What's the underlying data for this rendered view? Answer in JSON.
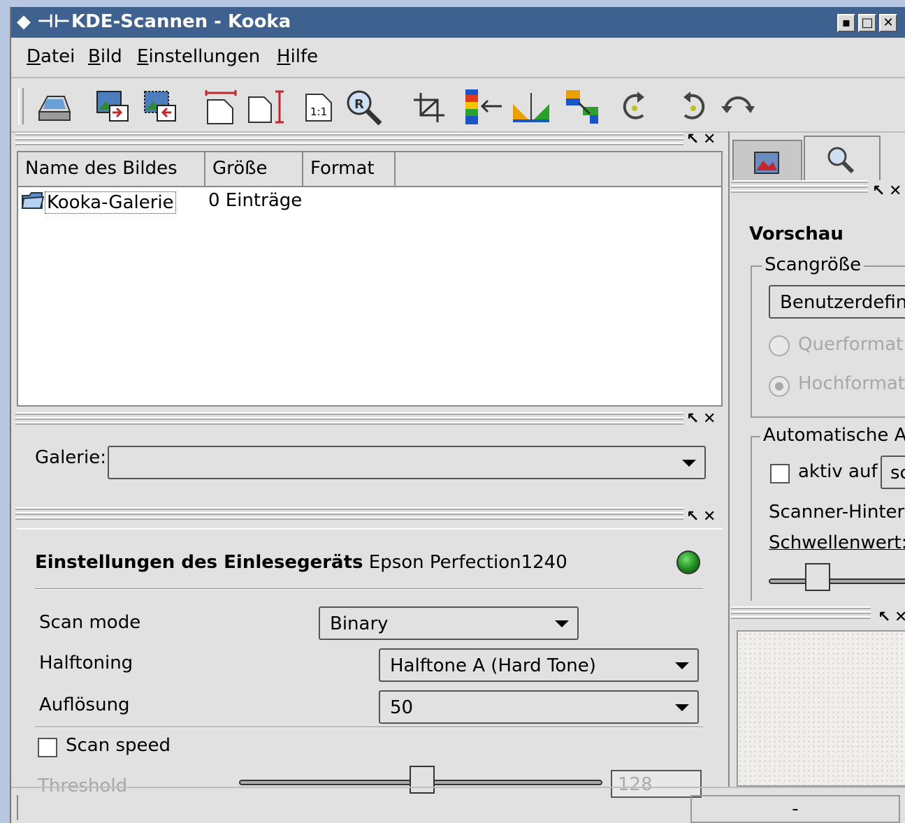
{
  "window": {
    "title": "KDE-Scannen - Kooka",
    "buttons": {
      "minimize": "▪",
      "maximize": "□",
      "close": "✕"
    }
  },
  "menu": [
    {
      "label_u": "D",
      "label_rest": "atei"
    },
    {
      "label_u": "B",
      "label_rest": "ild"
    },
    {
      "label_u": "E",
      "label_rest": "instellungen"
    },
    {
      "label_u": "H",
      "label_rest": "ilfe"
    }
  ],
  "toolbar": {
    "icons": [
      "scanner-icon",
      "gallery-export-icon",
      "gallery-import-icon",
      "fit-width-icon",
      "fit-height-icon",
      "original-size-icon",
      "ocr-icon",
      "crop-icon",
      "mirror-vertical-icon",
      "mirror-horizontal-icon",
      "mirror-both-icon",
      "rotate-clockwise-icon",
      "rotate-counterclockwise-icon",
      "rotate-180-icon"
    ],
    "original_size_text": "1:1"
  },
  "dock": {
    "undock": "↖",
    "close": "✕"
  },
  "gallery_list": {
    "columns": [
      "Name des Bildes",
      "Größe",
      "Format"
    ],
    "rows": [
      {
        "name": "Kooka-Galerie",
        "size": "0 Einträge",
        "format": ""
      }
    ]
  },
  "galerie": {
    "label": "Galerie:",
    "value": ""
  },
  "scanner": {
    "title_bold": "Einstellungen des Einlesegeräts",
    "device": "Epson Perfection1240",
    "status_color": "#1d8a1d",
    "scan_mode": {
      "label": "Scan mode",
      "value": "Binary"
    },
    "halftoning": {
      "label": "Halftoning",
      "value": "Halftone A (Hard Tone)"
    },
    "resolution": {
      "label": "Auflösung",
      "value": "50"
    },
    "scan_speed": {
      "label": "Scan speed",
      "checked": false
    },
    "threshold": {
      "label": "Threshold",
      "value": "128"
    }
  },
  "preview": {
    "tabs": [
      "preview-tab-icon",
      "zoom-tab-icon"
    ],
    "title": "Vorschau",
    "scan_size": {
      "group": "Scangröße",
      "value": "Benutzerdefini",
      "landscape": "Querformat",
      "portrait": "Hochformat"
    },
    "auto": {
      "group": "Automatische A",
      "active_label": "aktiv auf",
      "active_value": "sc",
      "background_label": "Scanner-Hinter",
      "threshold_label": "Schwellenwert:"
    }
  },
  "status": {
    "right": "-"
  }
}
